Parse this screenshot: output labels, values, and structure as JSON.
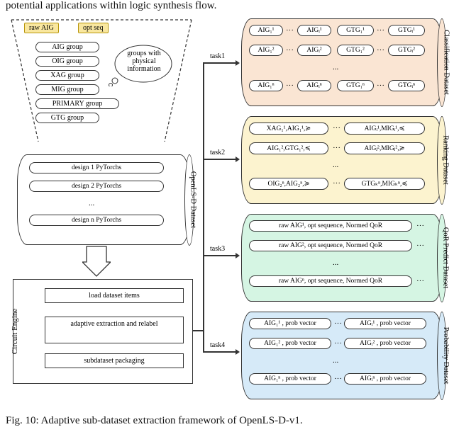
{
  "top_cutoff_text": "potential applications within logic synthesis flow.",
  "funnel": {
    "tag_raw": "raw AIG",
    "tag_opt": "opt seq",
    "groups": [
      "AIG group",
      "OIG group",
      "XAG group",
      "MIG group",
      "PRIMARY group",
      "GTG group"
    ],
    "speech": "groups with physical information"
  },
  "openlsd": {
    "title": "OpenLS-D Dataset",
    "rows": [
      "design 1 PyTorchs",
      "design 2 PyTorchs",
      "...",
      "design n PyTorchs"
    ]
  },
  "engine": {
    "title": "Circuit Engine",
    "steps": [
      "load dataset items",
      "adaptive extraction and relabel",
      "subdataset packaging"
    ]
  },
  "tasks": {
    "labels": [
      "task1",
      "task2",
      "task3",
      "task4"
    ],
    "classification": {
      "title": "Classification Dataset",
      "row1": [
        "AIG₁¹",
        "AIGᵢ¹",
        "GTG₁¹",
        "GTGᵢ¹"
      ],
      "row2": [
        "AIG₁²",
        "AIGᵢ²",
        "GTG₁²",
        "GTGᵢ²"
      ],
      "rown": [
        "AIG₁ⁿ",
        "AIGᵢⁿ",
        "GTG₁ⁿ",
        "GTGᵢⁿ"
      ]
    },
    "ranking": {
      "title": "Ranking Dataset",
      "row1": [
        "XAG₁¹,AIG₁¹,≽",
        "AIGᵢ¹,MIGᵢ¹,≼"
      ],
      "row2": [
        "AIG₁²,GTG₁²,≼",
        "AIGⱼ²,MIGⱼ²,≽"
      ],
      "rown": [
        "OIG₂ⁿ,AIG₂ⁿ,≽",
        "GTGₖⁿ,MIGₖⁿ,≼"
      ]
    },
    "qor": {
      "title": "QoR Predict Dataset",
      "row1": "raw AIG¹, opt sequence, Normed QoR",
      "row2": "raw AIG², opt sequence, Normed QoR",
      "rown": "raw AIGⁿ, opt sequence, Normed QoR"
    },
    "prob": {
      "title": "Probability Dataset",
      "row1": [
        "AIG₁¹ , prob vector",
        "AIGᵢ¹ , prob vector"
      ],
      "row2": [
        "AIG₁² , prob vector",
        "AIGᵢ² , prob vector"
      ],
      "rown": [
        "AIG₁ⁿ , prob vector",
        "AIGᵢⁿ , prob vector"
      ]
    }
  },
  "caption": "Fig. 10: Adaptive sub-dataset extraction framework of OpenLS-D-v1."
}
